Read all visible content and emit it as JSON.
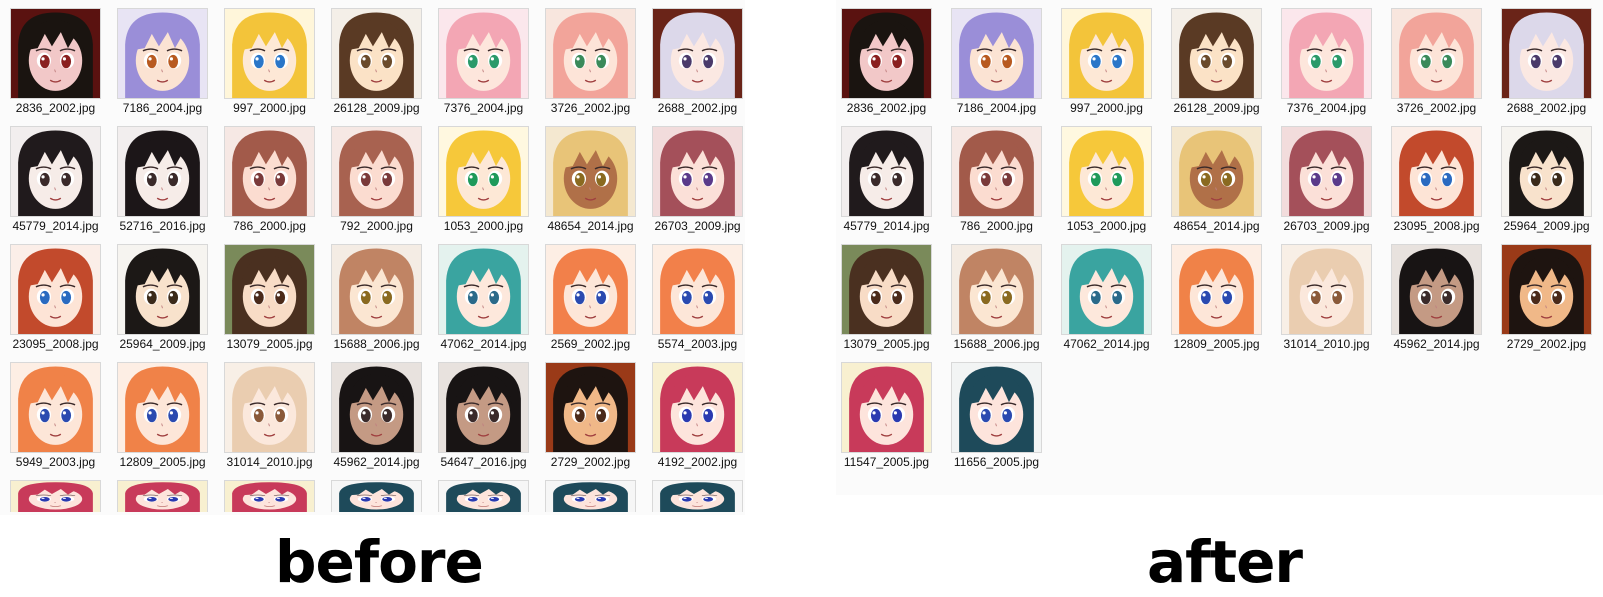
{
  "before": {
    "caption": "before",
    "files": [
      {
        "name": "2836_2002.jpg",
        "hair": "#1a1410",
        "skin": "#f2c8c8",
        "bg": "#5a1210",
        "eye": "#8a2020"
      },
      {
        "name": "7186_2004.jpg",
        "hair": "#9a8ed8",
        "skin": "#fbe3d3",
        "bg": "#e8e4f4",
        "eye": "#b85a20"
      },
      {
        "name": "997_2000.jpg",
        "hair": "#f3c43a",
        "skin": "#fde8d6",
        "bg": "#fff6da",
        "eye": "#2a76c8"
      },
      {
        "name": "26128_2009.jpg",
        "hair": "#5a3a24",
        "skin": "#fbe2c6",
        "bg": "#f4efe8",
        "eye": "#6a4a2a"
      },
      {
        "name": "7376_2004.jpg",
        "hair": "#f3a6b4",
        "skin": "#fde6dc",
        "bg": "#fbe7ec",
        "eye": "#2a9a6a"
      },
      {
        "name": "3726_2002.jpg",
        "hair": "#f2a49a",
        "skin": "#fde4d8",
        "bg": "#f8e6de",
        "eye": "#3a8a5a"
      },
      {
        "name": "2688_2002.jpg",
        "hair": "#dcd8ea",
        "skin": "#fbe8e2",
        "bg": "#6a2418",
        "eye": "#4a3a6a"
      },
      {
        "name": "45779_2014.jpg",
        "hair": "#201a1c",
        "skin": "#f6ece8",
        "bg": "#f2eeee",
        "eye": "#3a2a2a"
      },
      {
        "name": "52716_2016.jpg",
        "hair": "#1c1618",
        "skin": "#f6ece8",
        "bg": "#f2eeee",
        "eye": "#3a2a2a"
      },
      {
        "name": "786_2000.jpg",
        "hair": "#a25a4a",
        "skin": "#fbdcd0",
        "bg": "#f6e8e4",
        "eye": "#7a3a3a"
      },
      {
        "name": "792_2000.jpg",
        "hair": "#a86250",
        "skin": "#fbdcd0",
        "bg": "#f6e8e4",
        "eye": "#7a3a3a"
      },
      {
        "name": "1053_2000.jpg",
        "hair": "#f6c83a",
        "skin": "#fde8d6",
        "bg": "#fff8e0",
        "eye": "#1e9a5a"
      },
      {
        "name": "48654_2014.jpg",
        "hair": "#e8c478",
        "skin": "#b07048",
        "bg": "#f4e8d0",
        "eye": "#8a6a20"
      },
      {
        "name": "26703_2009.jpg",
        "hair": "#a4505a",
        "skin": "#fbe0d8",
        "bg": "#f2dcdc",
        "eye": "#5a3a8a"
      },
      {
        "name": "23095_2008.jpg",
        "hair": "#c24a2c",
        "skin": "#fde4d6",
        "bg": "#fbeee8",
        "eye": "#2a6ac0"
      },
      {
        "name": "25964_2009.jpg",
        "hair": "#1c1816",
        "skin": "#f8e2cc",
        "bg": "#f6f4f0",
        "eye": "#3a2a1a"
      },
      {
        "name": "13079_2005.jpg",
        "hair": "#4a3020",
        "skin": "#f8dcc6",
        "bg": "#7a8a5a",
        "eye": "#4a2a1a"
      },
      {
        "name": "15688_2006.jpg",
        "hair": "#c08464",
        "skin": "#fbe6d2",
        "bg": "#f4ece4",
        "eye": "#8a6a20"
      },
      {
        "name": "47062_2014.jpg",
        "hair": "#3aa4a0",
        "skin": "#fde8dc",
        "bg": "#e4f2ee",
        "eye": "#2a6a8a"
      },
      {
        "name": "2569_2002.jpg",
        "hair": "#f2804a",
        "skin": "#fde6d8",
        "bg": "#fdeee4",
        "eye": "#2a4ab0"
      },
      {
        "name": "5574_2003.jpg",
        "hair": "#f2804a",
        "skin": "#fde6d8",
        "bg": "#fdeee4",
        "eye": "#2a4ab0"
      },
      {
        "name": "5949_2003.jpg",
        "hair": "#f08248",
        "skin": "#fde6d8",
        "bg": "#fdeee4",
        "eye": "#2a4ab0"
      },
      {
        "name": "12809_2005.jpg",
        "hair": "#f08248",
        "skin": "#fde6d8",
        "bg": "#fdeee4",
        "eye": "#2a4ab0"
      },
      {
        "name": "31014_2010.jpg",
        "hair": "#eacdb0",
        "skin": "#fbe8dc",
        "bg": "#f8efe6",
        "eye": "#8a5a3a"
      },
      {
        "name": "45962_2014.jpg",
        "hair": "#181414",
        "skin": "#c49a84",
        "bg": "#e8e2de",
        "eye": "#3a2a2a"
      },
      {
        "name": "54647_2016.jpg",
        "hair": "#181414",
        "skin": "#c49a84",
        "bg": "#e8e2de",
        "eye": "#3a2a2a"
      },
      {
        "name": "2729_2002.jpg",
        "hair": "#1e1410",
        "skin": "#f0b888",
        "bg": "#9a3a18",
        "eye": "#4a2a1a"
      },
      {
        "name": "4192_2002.jpg",
        "hair": "#c83a5a",
        "skin": "#fde4dc",
        "bg": "#f8f0d0",
        "eye": "#2a3ab0"
      }
    ],
    "partial": [
      {
        "name": "",
        "hair": "#c83a5a",
        "skin": "#fde4dc",
        "bg": "#f8f0d0",
        "eye": "#2a3ab0"
      },
      {
        "name": "",
        "hair": "#c83a5a",
        "skin": "#fde4dc",
        "bg": "#f8f0d0",
        "eye": "#2a3ab0"
      },
      {
        "name": "",
        "hair": "#c83a5a",
        "skin": "#fde4dc",
        "bg": "#f8f0d0",
        "eye": "#2a3ab0"
      },
      {
        "name": "",
        "hair": "#1e4a5a",
        "skin": "#fde4dc",
        "bg": "#f6f6f6",
        "eye": "#2a3ab0"
      },
      {
        "name": "",
        "hair": "#1e4a5a",
        "skin": "#fde4dc",
        "bg": "#f6f6f6",
        "eye": "#2a3ab0"
      },
      {
        "name": "",
        "hair": "#1e4a5a",
        "skin": "#fde4dc",
        "bg": "#f6f6f6",
        "eye": "#2a3ab0"
      },
      {
        "name": "",
        "hair": "#1e4a5a",
        "skin": "#fde4dc",
        "bg": "#f6f6f6",
        "eye": "#2a3ab0"
      }
    ]
  },
  "after": {
    "caption": "after",
    "files": [
      {
        "name": "2836_2002.jpg",
        "hair": "#1a1410",
        "skin": "#f2c8c8",
        "bg": "#5a1210",
        "eye": "#8a2020"
      },
      {
        "name": "7186_2004.jpg",
        "hair": "#9a8ed8",
        "skin": "#fbe3d3",
        "bg": "#e8e4f4",
        "eye": "#b85a20"
      },
      {
        "name": "997_2000.jpg",
        "hair": "#f3c43a",
        "skin": "#fde8d6",
        "bg": "#fff6da",
        "eye": "#2a76c8"
      },
      {
        "name": "26128_2009.jpg",
        "hair": "#5a3a24",
        "skin": "#fbe2c6",
        "bg": "#f4efe8",
        "eye": "#6a4a2a"
      },
      {
        "name": "7376_2004.jpg",
        "hair": "#f3a6b4",
        "skin": "#fde6dc",
        "bg": "#fbe7ec",
        "eye": "#2a9a6a"
      },
      {
        "name": "3726_2002.jpg",
        "hair": "#f2a49a",
        "skin": "#fde4d8",
        "bg": "#f8e6de",
        "eye": "#3a8a5a"
      },
      {
        "name": "2688_2002.jpg",
        "hair": "#dcd8ea",
        "skin": "#fbe8e2",
        "bg": "#6a2418",
        "eye": "#4a3a6a"
      },
      {
        "name": "45779_2014.jpg",
        "hair": "#201a1c",
        "skin": "#f6ece8",
        "bg": "#f2eeee",
        "eye": "#3a2a2a"
      },
      {
        "name": "786_2000.jpg",
        "hair": "#a25a4a",
        "skin": "#fbdcd0",
        "bg": "#f6e8e4",
        "eye": "#7a3a3a"
      },
      {
        "name": "1053_2000.jpg",
        "hair": "#f6c83a",
        "skin": "#fde8d6",
        "bg": "#fff8e0",
        "eye": "#1e9a5a"
      },
      {
        "name": "48654_2014.jpg",
        "hair": "#e8c478",
        "skin": "#b07048",
        "bg": "#f4e8d0",
        "eye": "#8a6a20"
      },
      {
        "name": "26703_2009.jpg",
        "hair": "#a4505a",
        "skin": "#fbe0d8",
        "bg": "#f2dcdc",
        "eye": "#5a3a8a"
      },
      {
        "name": "23095_2008.jpg",
        "hair": "#c24a2c",
        "skin": "#fde4d6",
        "bg": "#fbeee8",
        "eye": "#2a6ac0"
      },
      {
        "name": "25964_2009.jpg",
        "hair": "#1c1816",
        "skin": "#f8e2cc",
        "bg": "#f6f4f0",
        "eye": "#3a2a1a"
      },
      {
        "name": "13079_2005.jpg",
        "hair": "#4a3020",
        "skin": "#f8dcc6",
        "bg": "#7a8a5a",
        "eye": "#4a2a1a"
      },
      {
        "name": "15688_2006.jpg",
        "hair": "#c08464",
        "skin": "#fbe6d2",
        "bg": "#f4ece4",
        "eye": "#8a6a20"
      },
      {
        "name": "47062_2014.jpg",
        "hair": "#3aa4a0",
        "skin": "#fde8dc",
        "bg": "#e4f2ee",
        "eye": "#2a6a8a"
      },
      {
        "name": "12809_2005.jpg",
        "hair": "#f08248",
        "skin": "#fde6d8",
        "bg": "#fdeee4",
        "eye": "#2a4ab0"
      },
      {
        "name": "31014_2010.jpg",
        "hair": "#eacdb0",
        "skin": "#fbe8dc",
        "bg": "#f8efe6",
        "eye": "#8a5a3a"
      },
      {
        "name": "45962_2014.jpg",
        "hair": "#181414",
        "skin": "#c49a84",
        "bg": "#e8e2de",
        "eye": "#3a2a2a"
      },
      {
        "name": "2729_2002.jpg",
        "hair": "#1e1410",
        "skin": "#f0b888",
        "bg": "#9a3a18",
        "eye": "#4a2a1a"
      },
      {
        "name": "11547_2005.jpg",
        "hair": "#c83a5a",
        "skin": "#fde4dc",
        "bg": "#f8f0d0",
        "eye": "#2a3ab0"
      },
      {
        "name": "11656_2005.jpg",
        "hair": "#1e4a5a",
        "skin": "#fde4dc",
        "bg": "#f2f4f4",
        "eye": "#2a4ab0"
      }
    ]
  }
}
